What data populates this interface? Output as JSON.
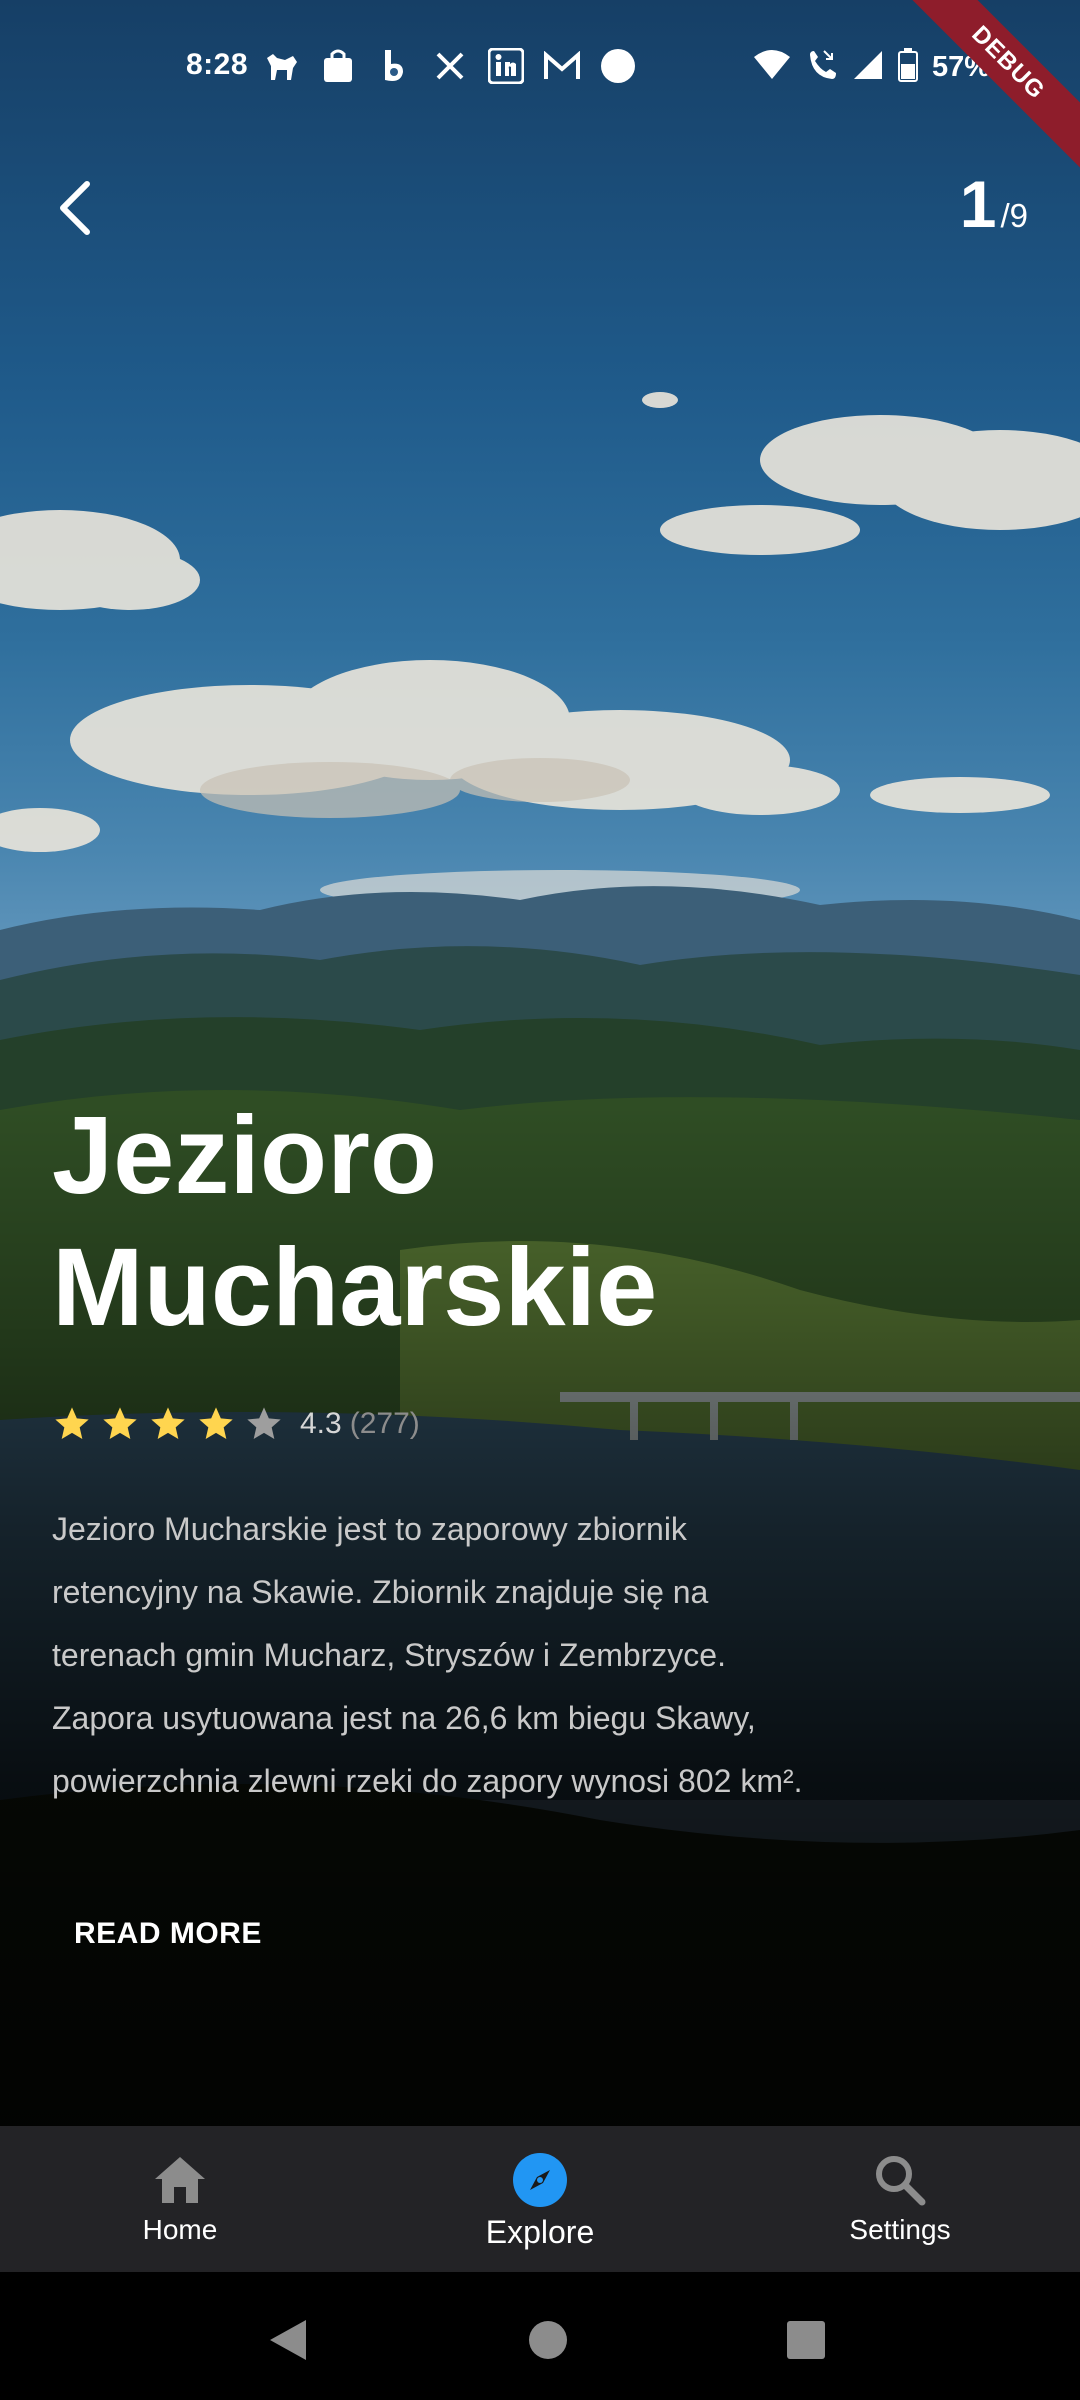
{
  "status": {
    "time": "8:28",
    "notification_icons": [
      "paw-icon",
      "shopping-bag-icon",
      "b-icon",
      "x-icon",
      "linkedin-icon",
      "gmail-icon",
      "circle-icon"
    ],
    "battery": "57%"
  },
  "debug_banner": "DEBUG",
  "pager": {
    "current": "1",
    "total": "/9"
  },
  "place": {
    "title_line1": "Jezioro",
    "title_line2": "Mucharskie",
    "rating": "4.3",
    "rating_count": "(277)",
    "stars": 4,
    "description": [
      "Jezioro Mucharskie jest to zaporowy zbiornik",
      "retencyjny na Skawie. Zbiornik znajduje się na",
      "terenach gmin Mucharz, Stryszów i Zembrzyce.",
      "Zapora usytuowana jest na 26,6 km biegu Skawy,",
      "powierzchnia zlewni rzeki do zapory wynosi 802 km²."
    ],
    "read_more": "READ MORE"
  },
  "nav": {
    "items": [
      {
        "label": "Home",
        "icon": "home-icon",
        "active": false
      },
      {
        "label": "Explore",
        "icon": "compass-icon",
        "active": true
      },
      {
        "label": "Settings",
        "icon": "search-icon",
        "active": false
      }
    ]
  },
  "colors": {
    "accent": "#2196F3",
    "star": "#FFD54F",
    "nav_bg": "#232326",
    "ribbon": "#8E1D2B"
  }
}
